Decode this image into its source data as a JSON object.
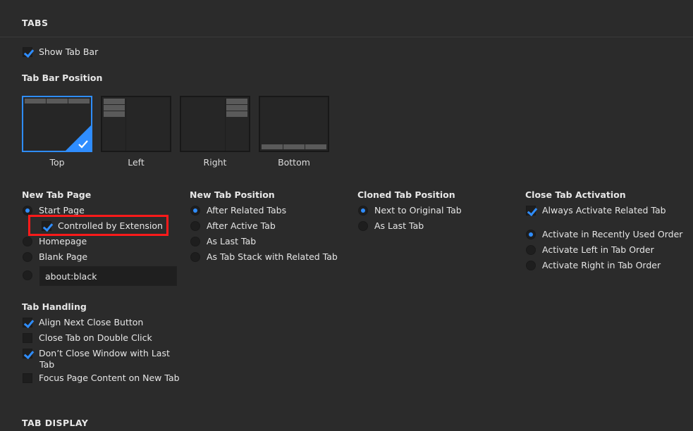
{
  "sections": {
    "tabs": "TABS",
    "tab_display": "TAB DISPLAY"
  },
  "show_tab_bar": {
    "label": "Show Tab Bar",
    "checked": true
  },
  "tab_bar_position": {
    "title": "Tab Bar Position",
    "options": [
      {
        "label": "Top",
        "selected": true
      },
      {
        "label": "Left",
        "selected": false
      },
      {
        "label": "Right",
        "selected": false
      },
      {
        "label": "Bottom",
        "selected": false
      }
    ]
  },
  "new_tab_page": {
    "title": "New Tab Page",
    "start_page": "Start Page",
    "controlled": "Controlled by Extension",
    "homepage": "Homepage",
    "blank_page": "Blank Page",
    "custom_value": "about:black"
  },
  "new_tab_position": {
    "title": "New Tab Position",
    "options": [
      "After Related Tabs",
      "After Active Tab",
      "As Last Tab",
      "As Tab Stack with Related Tab"
    ]
  },
  "cloned_tab_position": {
    "title": "Cloned Tab Position",
    "options": [
      "Next to Original Tab",
      "As Last Tab"
    ]
  },
  "close_tab_activation": {
    "title": "Close Tab Activation",
    "always_related": "Always Activate Related Tab",
    "options": [
      "Activate in Recently Used Order",
      "Activate Left in Tab Order",
      "Activate Right in Tab Order"
    ]
  },
  "tab_handling": {
    "title": "Tab Handling",
    "align": "Align Next Close Button",
    "double_click": "Close Tab on Double Click",
    "dont_close_1": "Don’t Close Window with Last",
    "dont_close_2": "Tab",
    "focus": "Focus Page Content on New Tab"
  },
  "colors": {
    "accent": "#2f8dff",
    "highlight": "#ff1a1a",
    "background": "#2b2b2b"
  }
}
